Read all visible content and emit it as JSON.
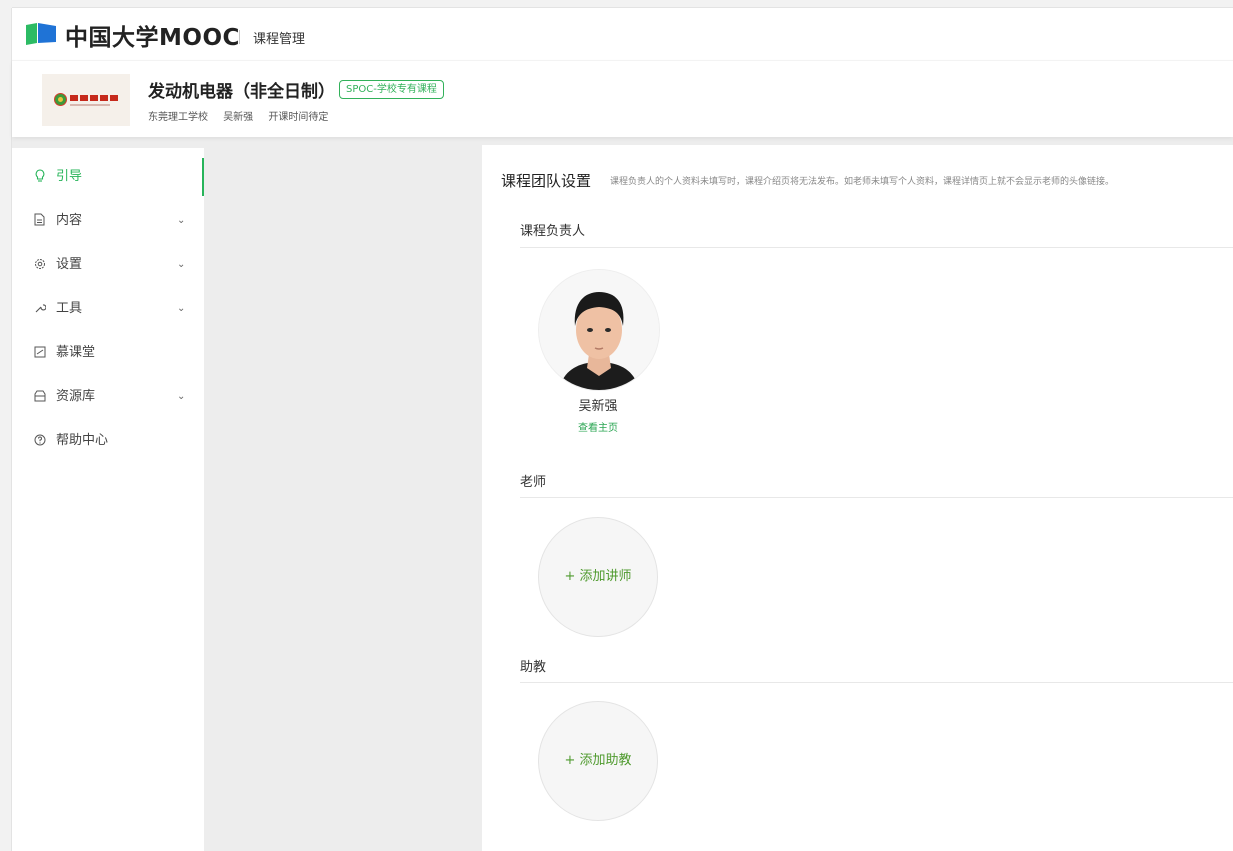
{
  "brand": {
    "logo_text": "中国大学MOOC",
    "section_title": "课程管理",
    "accent_color": "#27b45a"
  },
  "course": {
    "name": "发动机电器（非全日制）",
    "tag": "SPOC-学校专有课程",
    "school": "东莞理工学校",
    "teacher": "吴新强",
    "schedule": "开课时间待定"
  },
  "sidebar": {
    "items": [
      {
        "icon": "lightbulb-icon",
        "label": "引导",
        "has_children": false,
        "active": true
      },
      {
        "icon": "document-icon",
        "label": "内容",
        "has_children": true,
        "active": false
      },
      {
        "icon": "gear-icon",
        "label": "设置",
        "has_children": true,
        "active": false
      },
      {
        "icon": "wrench-icon",
        "label": "工具",
        "has_children": true,
        "active": false
      },
      {
        "icon": "classroom-icon",
        "label": "慕课堂",
        "has_children": false,
        "active": false
      },
      {
        "icon": "box-icon",
        "label": "资源库",
        "has_children": true,
        "active": false
      },
      {
        "icon": "help-icon",
        "label": "帮助中心",
        "has_children": false,
        "active": false
      }
    ],
    "chevron": "⌄"
  },
  "main": {
    "title": "课程团队设置",
    "hint": "课程负责人的个人资料未填写时，课程介绍页将无法发布。如老师未填写个人资料，课程详情页上就不会显示老师的头像链接。",
    "owner_section": "课程负责人",
    "owner": {
      "name": "吴新强",
      "link": "查看主页"
    },
    "teacher_section": "老师",
    "add_teacher": "+ 添加讲师",
    "assistant_section": "助教",
    "add_assistant": "+ 添加助教"
  }
}
